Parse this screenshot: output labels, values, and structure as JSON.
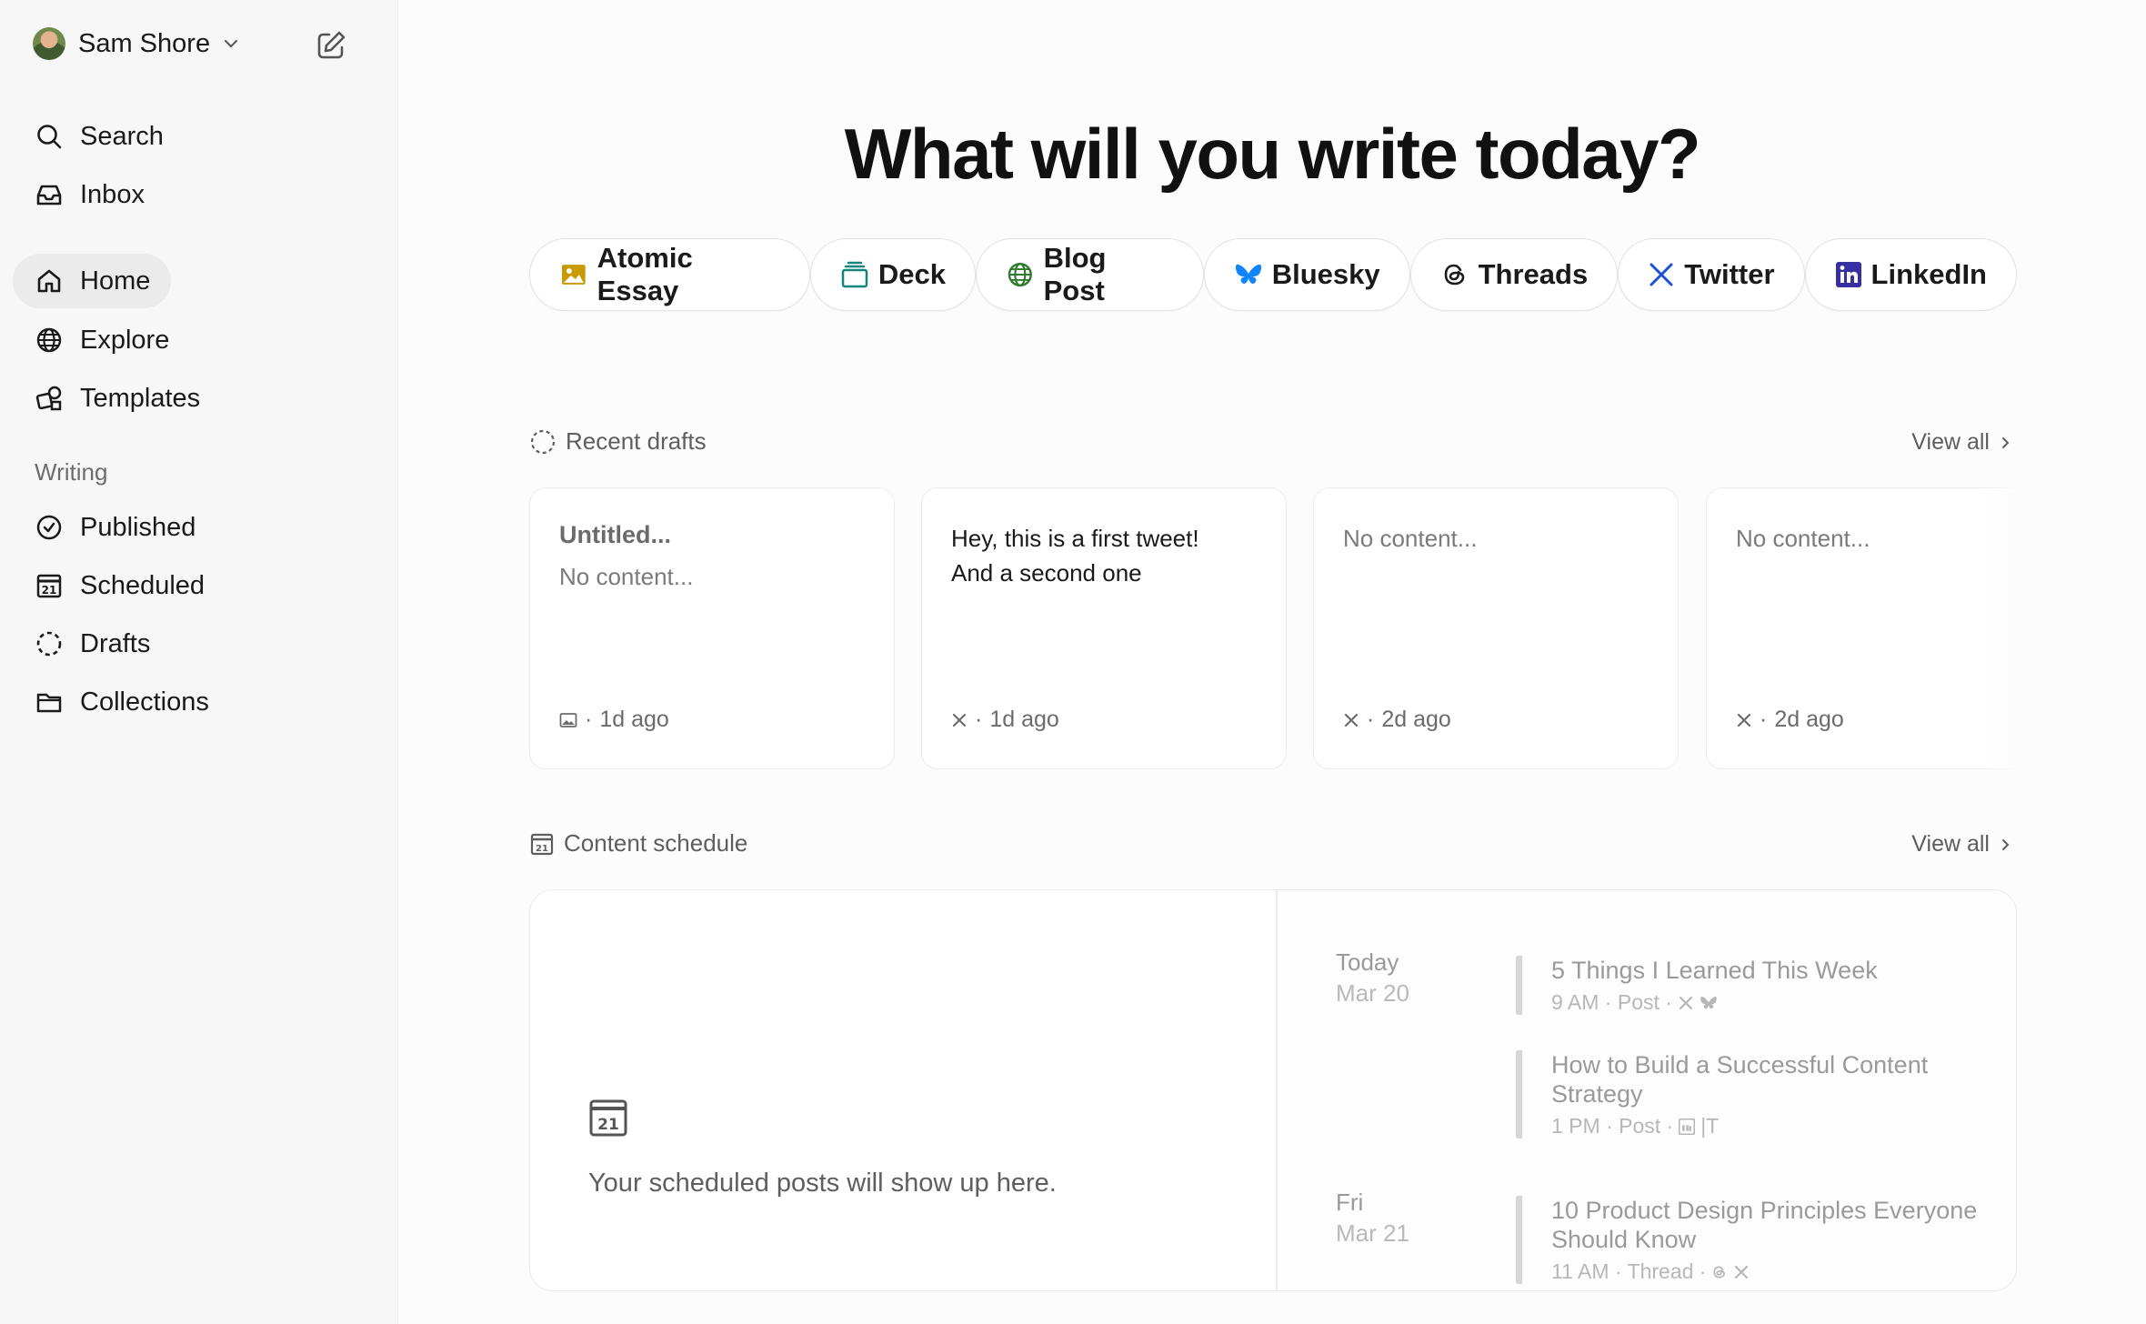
{
  "user": {
    "name": "Sam Shore"
  },
  "nav": {
    "search": "Search",
    "inbox": "Inbox",
    "home": "Home",
    "explore": "Explore",
    "templates": "Templates",
    "writing_label": "Writing",
    "published": "Published",
    "scheduled": "Scheduled",
    "drafts": "Drafts",
    "collections": "Collections"
  },
  "main": {
    "headline": "What will you write today?",
    "chips": [
      "Atomic Essay",
      "Deck",
      "Blog Post",
      "Bluesky",
      "Threads",
      "Twitter",
      "LinkedIn"
    ]
  },
  "recent": {
    "title": "Recent drafts",
    "view_all": "View all",
    "drafts": [
      {
        "title": "Untitled...",
        "body": "No content...",
        "time": "1d ago",
        "icon": "image-icon"
      },
      {
        "line1": "Hey, this is a first tweet!",
        "line2": "And a second one",
        "time": "1d ago",
        "icon": "x-icon"
      },
      {
        "body": "No content...",
        "time": "2d ago",
        "icon": "x-icon"
      },
      {
        "body": "No content...",
        "time": "2d ago",
        "icon": "x-icon"
      }
    ]
  },
  "schedule": {
    "title": "Content schedule",
    "view_all": "View all",
    "empty_day": "21",
    "empty_text": "Your scheduled posts will show up here.",
    "days": [
      {
        "label": "Today",
        "date": "Mar 20"
      },
      {
        "label": "Fri",
        "date": "Mar 21"
      }
    ],
    "events": [
      {
        "title": "5 Things I Learned This Week",
        "meta": "9 AM · Post ·"
      },
      {
        "title_1": "How to Build a Successful Content",
        "title_2": "Strategy",
        "meta": "1 PM · Post ·",
        "extra": "|T"
      },
      {
        "title_1": "10 Product Design Principles Everyone",
        "title_2": "Should Know",
        "meta": "11 AM · Thread ·"
      }
    ]
  },
  "colors": {
    "bluesky": "#1185fe",
    "twitter": "#1d4ed8",
    "linkedin": "#3730a3",
    "essay": "#c99a06",
    "deck": "#14857a",
    "blog": "#2f7a2f"
  }
}
